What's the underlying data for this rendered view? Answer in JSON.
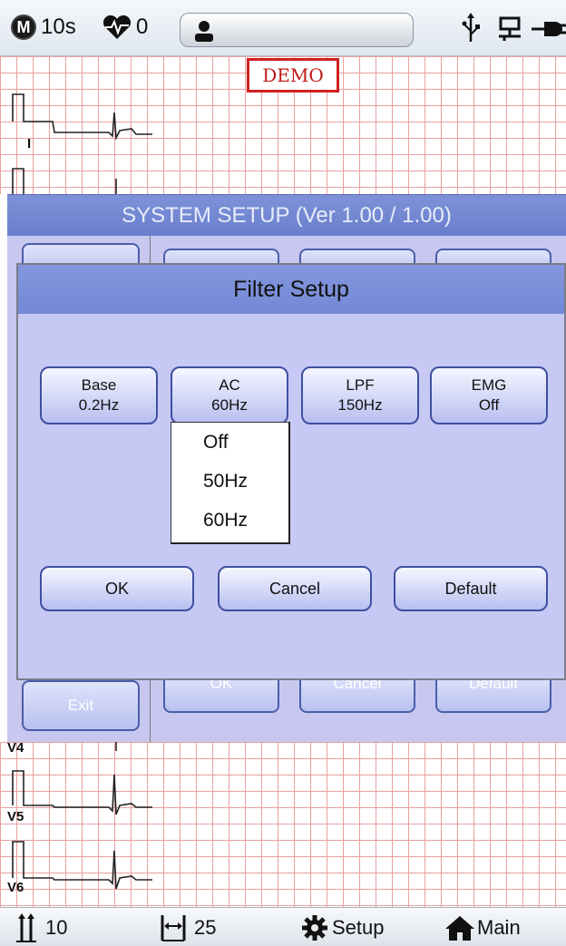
{
  "status_bar": {
    "mode_icon_letter": "M",
    "duration": "10s",
    "heart_rate": "0"
  },
  "demo_label": "DEMO",
  "leads_top": [
    "I"
  ],
  "leads_bottom": [
    "V4",
    "V5",
    "V6"
  ],
  "system_setup": {
    "title": "SYSTEM SETUP (Ver 1.00 / 1.00)",
    "exit_label": "Exit",
    "bg_ok": "OK",
    "bg_cancel": "Cancel",
    "bg_default": "Default"
  },
  "filter_dialog": {
    "title": "Filter Setup",
    "filters": [
      {
        "name": "Base",
        "value": "0.2Hz"
      },
      {
        "name": "AC",
        "value": "60Hz"
      },
      {
        "name": "LPF",
        "value": "150Hz"
      },
      {
        "name": "EMG",
        "value": "Off"
      }
    ],
    "ac_options": [
      "Off",
      "50Hz",
      "60Hz"
    ],
    "ok_label": "OK",
    "cancel_label": "Cancel",
    "default_label": "Default"
  },
  "toolbar": {
    "gain": "10",
    "speed": "25",
    "setup_label": "Setup",
    "main_label": "Main"
  },
  "colors": {
    "header_blue": "#7389d6",
    "dialog_bg": "#c7c9f5",
    "grid_red": "#e8a0a0",
    "demo_red": "#d02020"
  }
}
